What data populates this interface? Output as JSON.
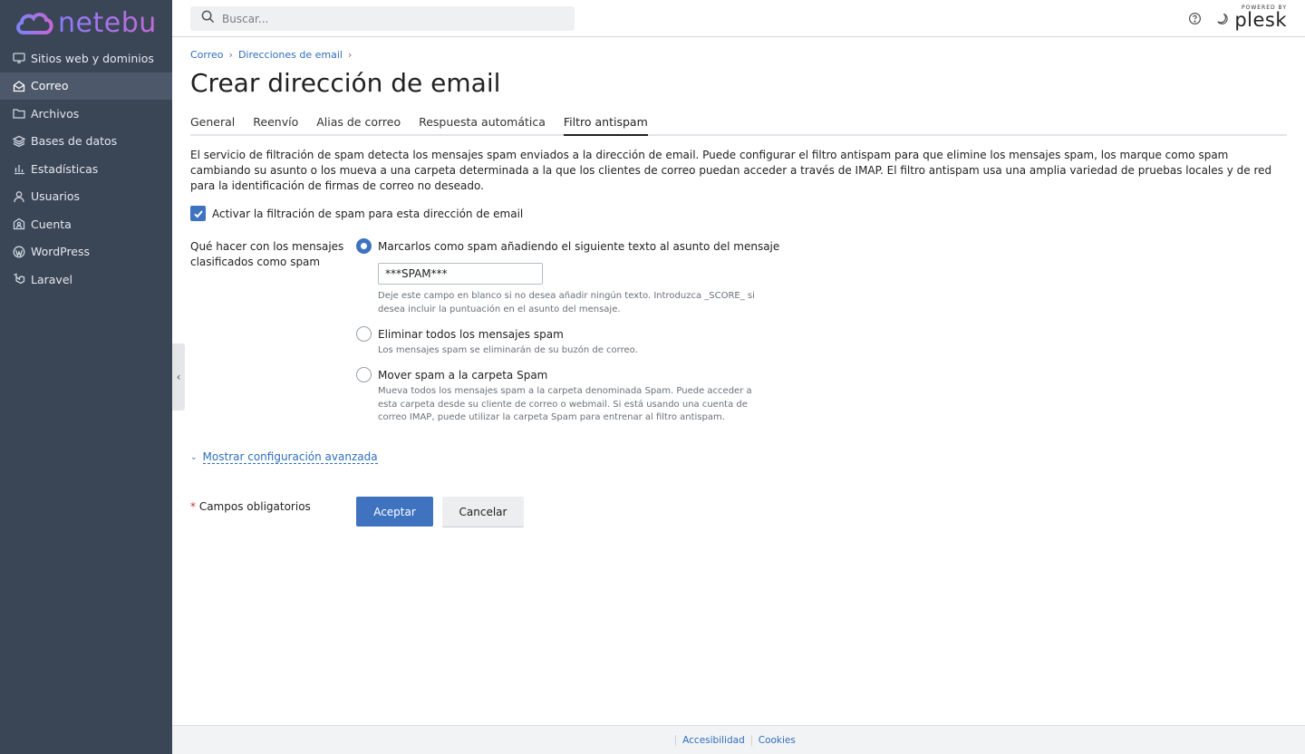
{
  "brand": {
    "name": "netebu"
  },
  "sidebar": {
    "items": [
      {
        "label": "Sitios web y dominios",
        "icon": "monitor-icon"
      },
      {
        "label": "Correo",
        "icon": "mail-icon",
        "active": true
      },
      {
        "label": "Archivos",
        "icon": "folder-icon"
      },
      {
        "label": "Bases de datos",
        "icon": "database-icon"
      },
      {
        "label": "Estadísticas",
        "icon": "bar-chart-icon"
      },
      {
        "label": "Usuarios",
        "icon": "user-icon"
      },
      {
        "label": "Cuenta",
        "icon": "account-icon"
      },
      {
        "label": "WordPress",
        "icon": "wordpress-icon"
      },
      {
        "label": "Laravel",
        "icon": "laravel-icon"
      }
    ]
  },
  "header": {
    "search_placeholder": "Buscar...",
    "powered_by": "POWERED BY",
    "plesk": "plesk"
  },
  "breadcrumb": [
    "Correo",
    "Direcciones de email"
  ],
  "page": {
    "title": "Crear dirección de email",
    "tabs": [
      "General",
      "Reenvío",
      "Alias de correo",
      "Respuesta automática",
      "Filtro antispam"
    ],
    "active_tab": "Filtro antispam",
    "description": "El servicio de filtración de spam detecta los mensajes spam enviados a la dirección de email. Puede configurar el filtro antispam para que elimine los mensajes spam, los marque como spam cambiando su asunto o los mueva a una carpeta determinada a la que los clientes de correo puedan acceder a través de IMAP. El filtro antispam usa una amplia variedad de pruebas locales y de red para la identificación de firmas de correo no deseado.",
    "enable_checkbox": {
      "label": "Activar la filtración de spam para esta dirección de email",
      "checked": true
    },
    "spam_action_label": "Qué hacer con los mensajes clasificados como spam",
    "options": [
      {
        "label": "Marcarlos como spam añadiendo el siguiente texto al asunto del mensaje",
        "checked": true,
        "hint": "Deje este campo en blanco si no desea añadir ningún texto. Introduzca _SCORE_ si desea incluir la puntuación en el asunto del mensaje."
      },
      {
        "label": "Eliminar todos los mensajes spam",
        "checked": false,
        "hint": "Los mensajes spam se eliminarán de su buzón de correo."
      },
      {
        "label": "Mover spam a la carpeta Spam",
        "checked": false,
        "hint": "Mueva todos los mensajes spam a la carpeta denominada Spam. Puede acceder a esta carpeta desde su cliente de correo o webmail. Si está usando una cuenta de correo IMAP, puede utilizar la carpeta Spam para entrenar al filtro antispam."
      }
    ],
    "subject_text_value": "***SPAM***",
    "advanced_link": "Mostrar configuración avanzada",
    "required_star": "*",
    "required_label": "Campos obligatorios",
    "ok_button": "Aceptar",
    "cancel_button": "Cancelar"
  },
  "footer": {
    "links": [
      "Accesibilidad",
      "Cookies"
    ]
  },
  "colors": {
    "sidebar_bg": "#3a4556",
    "accent": "#3f73c0",
    "link": "#2e6fba"
  }
}
